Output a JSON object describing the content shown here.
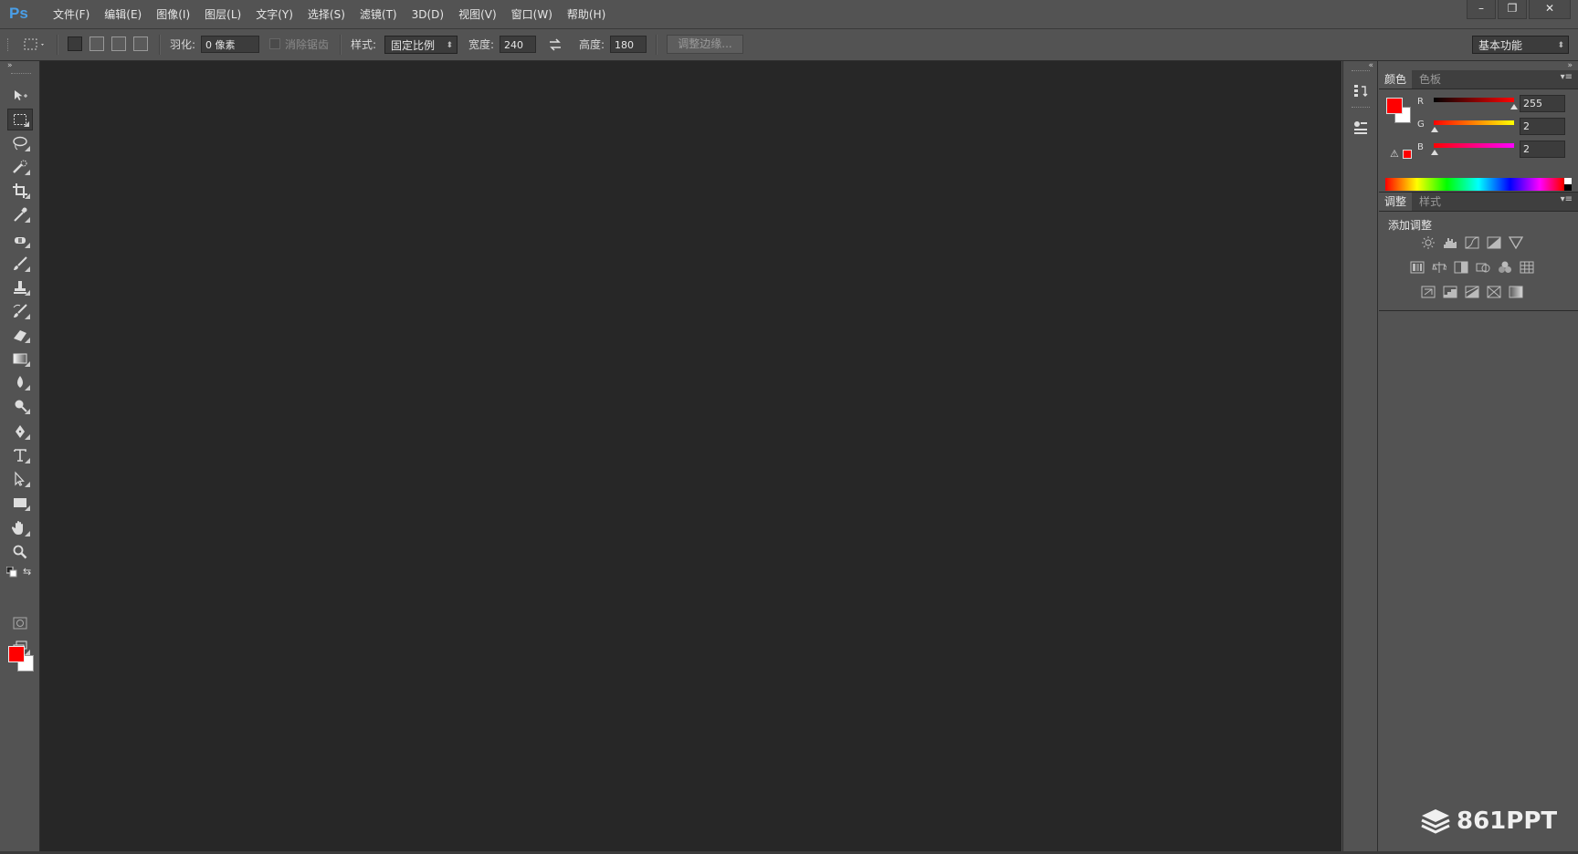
{
  "app": {
    "logo": "Ps"
  },
  "menu": [
    "文件(F)",
    "编辑(E)",
    "图像(I)",
    "图层(L)",
    "文字(Y)",
    "选择(S)",
    "滤镜(T)",
    "3D(D)",
    "视图(V)",
    "窗口(W)",
    "帮助(H)"
  ],
  "window_controls": {
    "minimize": "–",
    "restore": "❐",
    "close": "✕"
  },
  "options": {
    "feather_label": "羽化:",
    "feather_value": "0 像素",
    "antialias_label": "消除锯齿",
    "style_label": "样式:",
    "style_value": "固定比例",
    "width_label": "宽度:",
    "width_value": "240",
    "height_label": "高度:",
    "height_value": "180",
    "refine_edge": "调整边缘...",
    "workspace": "基本功能"
  },
  "tools": [
    "move-tool",
    "rectangular-marquee-tool",
    "lasso-tool",
    "quick-selection-tool",
    "crop-tool",
    "eyedropper-tool",
    "spot-healing-brush-tool",
    "brush-tool",
    "clone-stamp-tool",
    "history-brush-tool",
    "eraser-tool",
    "gradient-tool",
    "blur-tool",
    "dodge-tool",
    "pen-tool",
    "type-tool",
    "path-selection-tool",
    "rectangle-tool",
    "hand-tool",
    "zoom-tool"
  ],
  "active_tool": "rectangular-marquee-tool",
  "colors": {
    "foreground": "#ff0000",
    "background": "#ffffff",
    "canvas": "#272727",
    "ui": "#535353"
  },
  "color_panel": {
    "tabs": [
      "颜色",
      "色板"
    ],
    "channels": [
      {
        "label": "R",
        "value": "255"
      },
      {
        "label": "G",
        "value": "2"
      },
      {
        "label": "B",
        "value": "2"
      }
    ],
    "gamut_icon": "⚠"
  },
  "adjustments_panel": {
    "tabs": [
      "调整",
      "样式"
    ],
    "header": "添加调整"
  },
  "watermark": "861PPT"
}
